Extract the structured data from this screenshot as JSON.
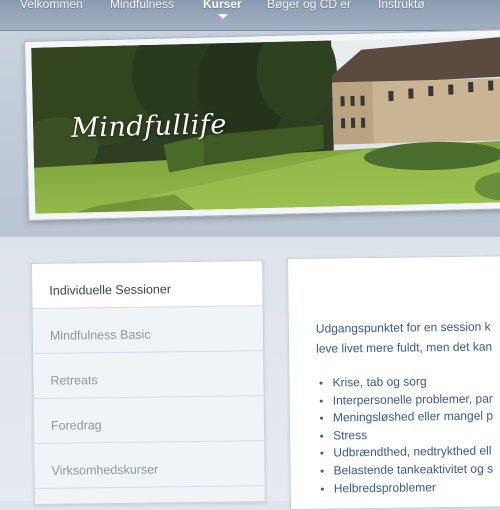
{
  "nav": {
    "items": [
      {
        "label": "Velkommen"
      },
      {
        "label": "Mindfulness"
      },
      {
        "label": "Kurser"
      },
      {
        "label": "Bøger og CD er"
      },
      {
        "label": "Instruktø"
      }
    ],
    "active": "Kurser"
  },
  "banner": {
    "title": "Mindfullife"
  },
  "sidebar": {
    "items": [
      {
        "label": "Individuelle Sessioner"
      },
      {
        "label": "Mindfulness Basic"
      },
      {
        "label": "Retreats"
      },
      {
        "label": "Foredrag"
      },
      {
        "label": "Virksomhedskurser"
      }
    ],
    "active_index": 0
  },
  "main": {
    "intro_line1": "Udgangspunktet for en session k",
    "intro_line2": "leve livet mere fuldt, men det kan",
    "bullets": [
      "Krise, tab og sorg",
      "Interpersonelle problemer, par",
      "Meningsløshed eller mangel p",
      "Stress",
      "Udbrændthed, nedtrykthed ell",
      "Belastende tankeaktivitet og s",
      "Helbredsproblemer"
    ]
  },
  "colors": {
    "nav_bar": "#95a4b8",
    "link_blue": "#3a5a8a",
    "menu_text": "#8d97a3",
    "background": "#dfe5ec"
  }
}
